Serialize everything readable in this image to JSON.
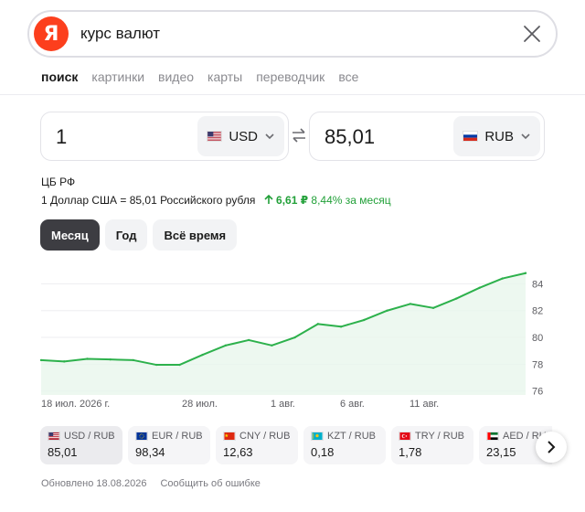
{
  "search": {
    "logo": "Я",
    "query": "курс валют"
  },
  "nav": {
    "tabs": [
      "поиск",
      "картинки",
      "видео",
      "карты",
      "переводчик",
      "все"
    ],
    "active": 0
  },
  "converter": {
    "from_amount": "1",
    "from_currency": "USD",
    "to_amount": "85,01",
    "to_currency": "RUB"
  },
  "info": {
    "source": "ЦБ РФ",
    "rate_text": "1 Доллар США = 85,01 Российского рубля",
    "change_abs": "6,61 ₽",
    "change_pct": "8,44%",
    "change_period": "за месяц",
    "change_color": "#21a038"
  },
  "periods": [
    "Месяц",
    "Год",
    "Всё время"
  ],
  "chart_data": {
    "type": "area",
    "x_ticks": [
      "18 июл. 2026 г.",
      "28 июл.",
      "1 авг.",
      "6 авг.",
      "11 авг."
    ],
    "y_ticks": [
      84,
      82,
      80,
      78,
      76
    ],
    "ylim": [
      75.7,
      85.6
    ],
    "series": [
      {
        "values": [
          78.3,
          78.2,
          78.4,
          78.35,
          78.3,
          77.95,
          77.95,
          78.7,
          79.4,
          79.8,
          79.4,
          80.0,
          81.0,
          80.8,
          81.3,
          82.0,
          82.5,
          82.2,
          82.9,
          83.7,
          84.4,
          84.8
        ]
      }
    ],
    "line_color": "#2db14c",
    "fill_color": "#e9f6ec",
    "grid": true
  },
  "chips": [
    {
      "pair": "USD / RUB",
      "rate": "85,01",
      "flag": "us"
    },
    {
      "pair": "EUR / RUB",
      "rate": "98,34",
      "flag": "eu"
    },
    {
      "pair": "CNY / RUB",
      "rate": "12,63",
      "flag": "cn"
    },
    {
      "pair": "KZT / RUB",
      "rate": "0,18",
      "flag": "kz"
    },
    {
      "pair": "TRY / RUB",
      "rate": "1,78",
      "flag": "tr"
    },
    {
      "pair": "AED / RUB",
      "rate": "23,15",
      "flag": "ae"
    }
  ],
  "footer": {
    "updated": "Обновлено 18.08.2026",
    "report": "Сообщить об ошибке"
  }
}
